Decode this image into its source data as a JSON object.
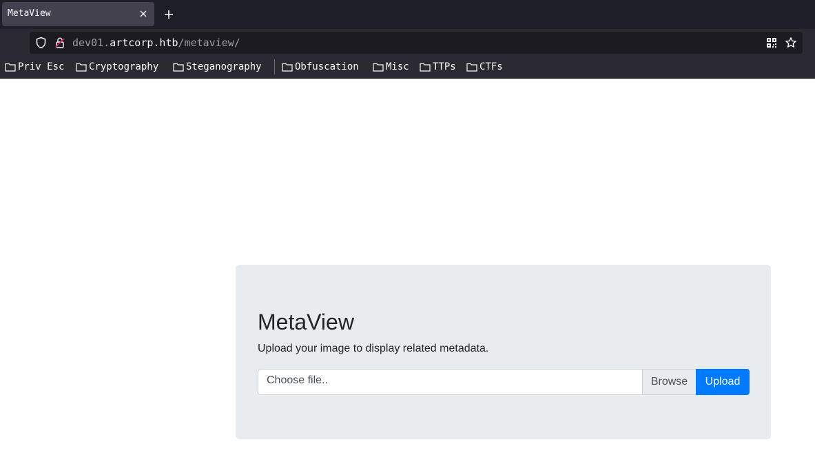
{
  "browser": {
    "tab": {
      "title": "MetaView"
    },
    "url": {
      "prefix": "dev01.",
      "host": "artcorp.htb",
      "path": "/metaview/"
    },
    "bookmarks": [
      {
        "label": "Priv Esc"
      },
      {
        "label": "Cryptography"
      },
      {
        "label": "Steganography"
      },
      {
        "label": "Obfuscation"
      },
      {
        "label": "Misc"
      },
      {
        "label": "TTPs"
      },
      {
        "label": "CTFs"
      }
    ],
    "icons": [
      "close-icon",
      "plus-icon",
      "shield-icon",
      "lock-icon",
      "qr-code-icon",
      "star-icon",
      "folder-icon"
    ]
  },
  "page": {
    "title": "MetaView",
    "description": "Upload your image to display related metadata.",
    "file_input": {
      "placeholder": "Choose file..",
      "browse_label": "Browse"
    },
    "upload_label": "Upload",
    "colors": {
      "jumbotron_bg": "#e9ecef",
      "primary": "#007bff"
    }
  }
}
